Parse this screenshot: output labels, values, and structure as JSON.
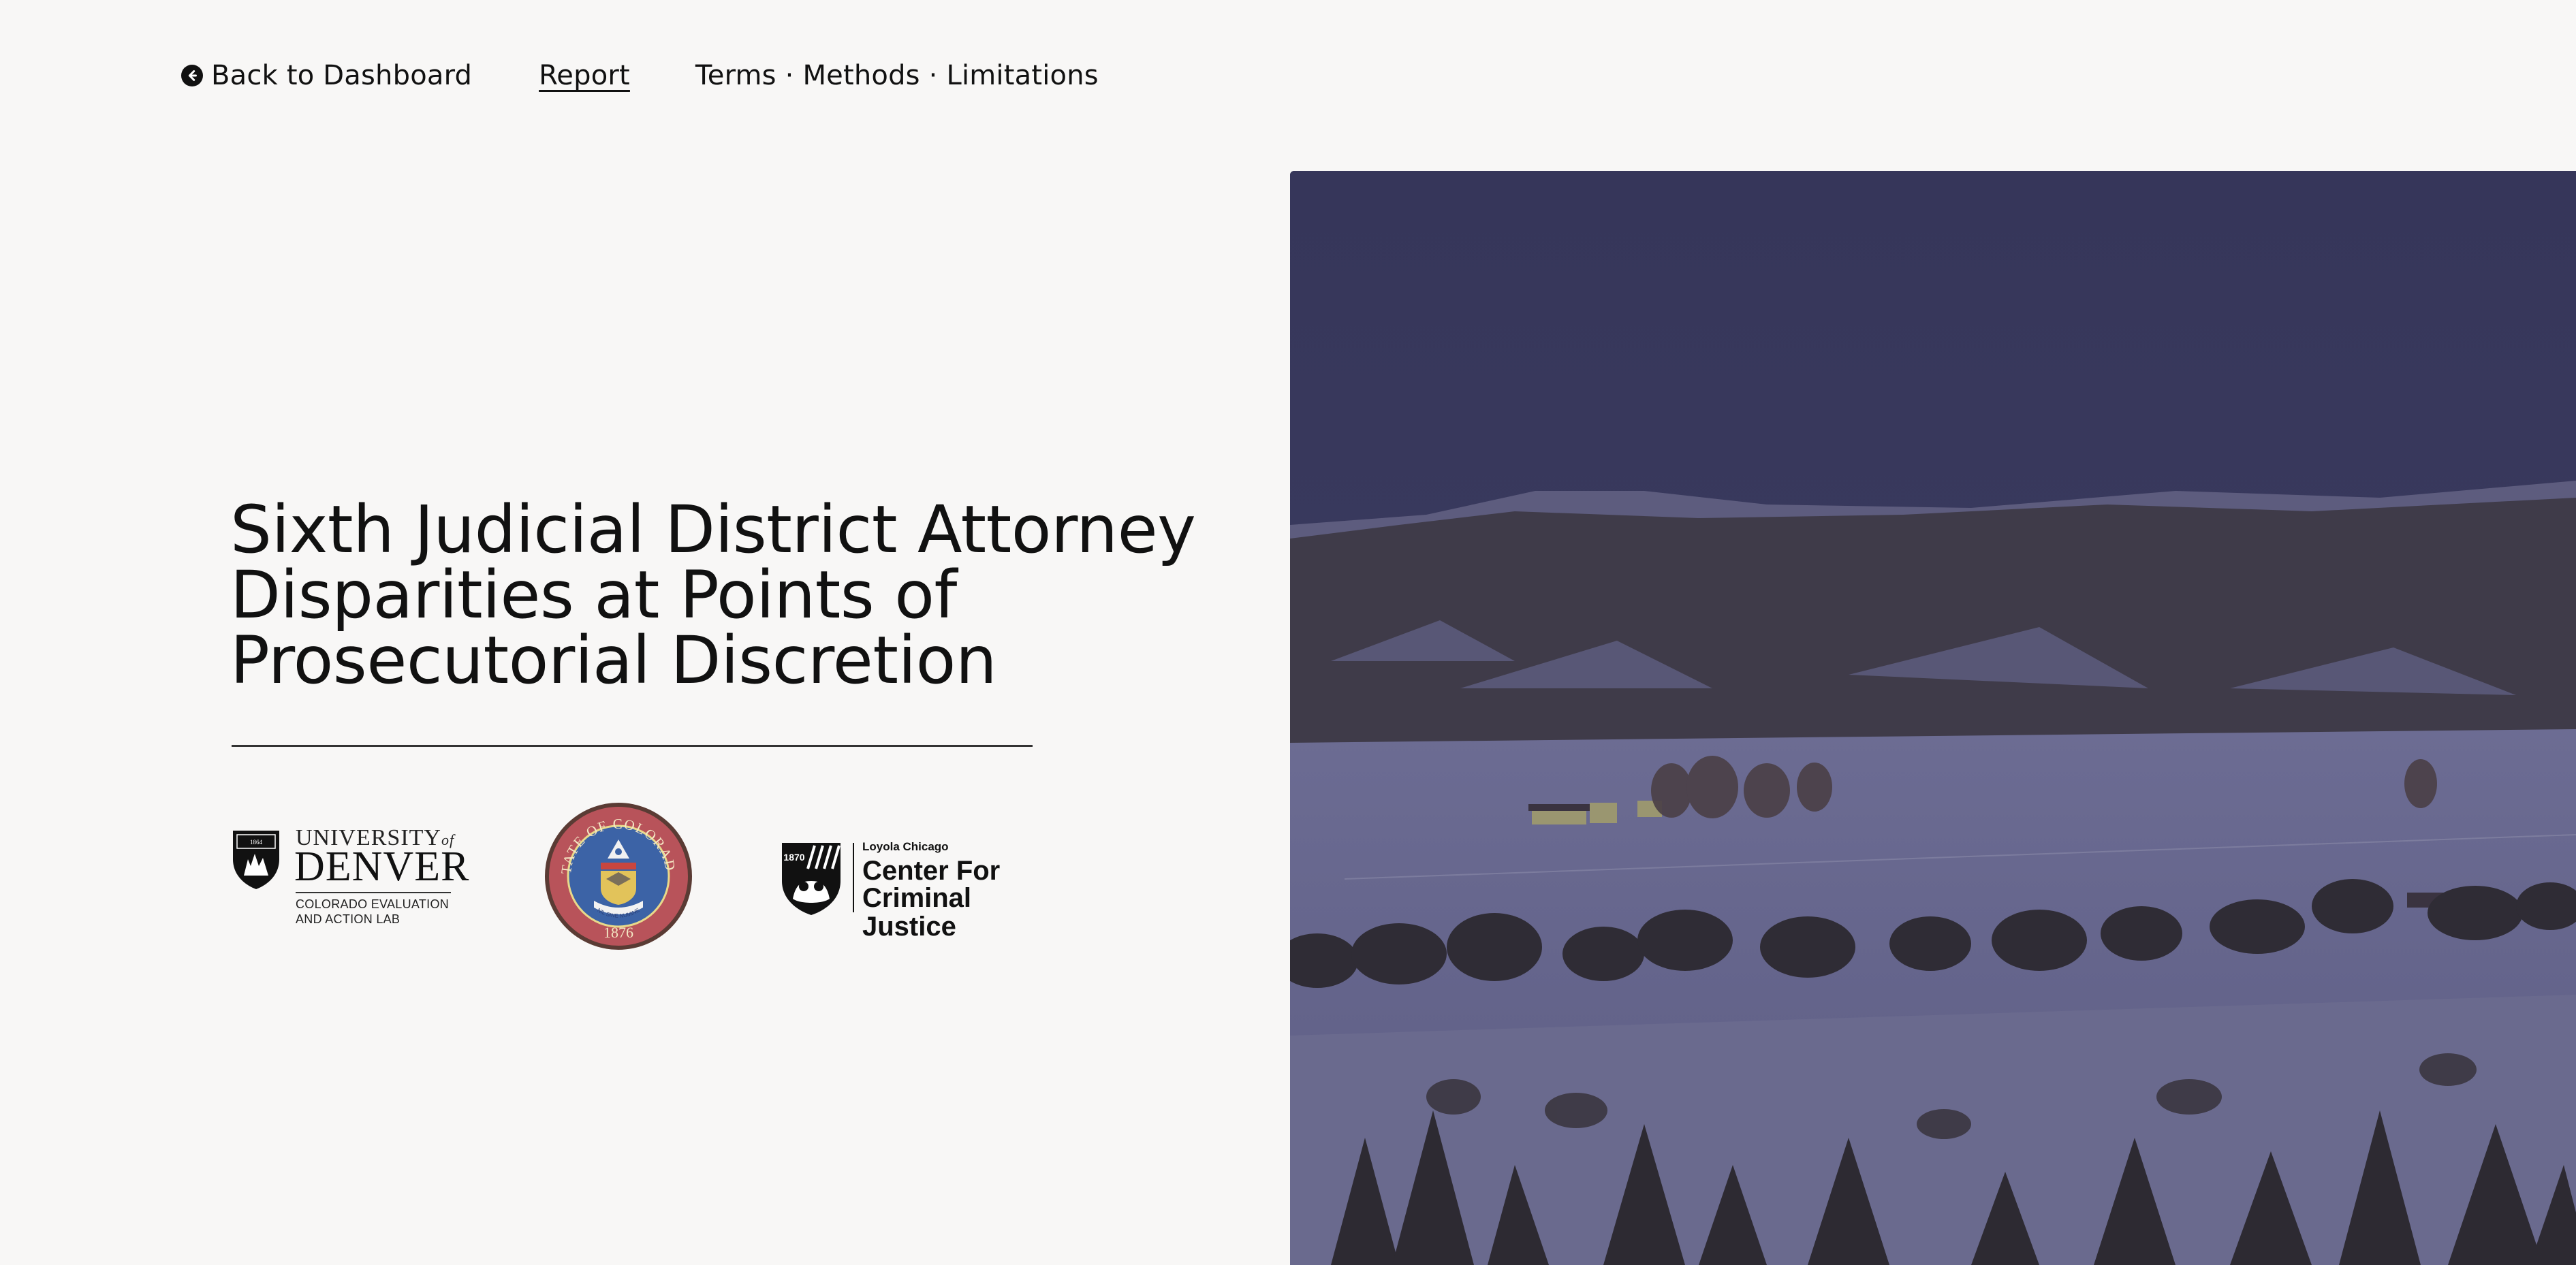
{
  "nav": {
    "back_label": "Back to Dashboard",
    "back_icon": "arrow-left-circle-icon",
    "report_label": "Report",
    "terms_label": "Terms · Methods · Limitations"
  },
  "title": {
    "line1": "Sixth Judicial District Attorney",
    "line2": "Disparities at Points of",
    "line3": "Prosecutorial Discretion"
  },
  "logos": {
    "du": {
      "university": "UNIVERSITY",
      "of": "of",
      "denver": "DENVER",
      "lab_line1": "COLORADO EVALUATION",
      "lab_line2": "AND ACTION LAB",
      "crest_year": "1864"
    },
    "seal": {
      "top_text": "STATE OF COLORADO",
      "motto": "NIL SINE NUMINE",
      "year": "1876"
    },
    "ccj": {
      "year": "1870",
      "loyola": "Loyola Chicago",
      "line1": "Center For",
      "line2": "Criminal Justice"
    }
  },
  "hero": {
    "icon": "landscape-photo",
    "colors": {
      "sky": "#3b3c5d",
      "snow": "#6a6a8f",
      "trees": "#2e2b33"
    }
  }
}
